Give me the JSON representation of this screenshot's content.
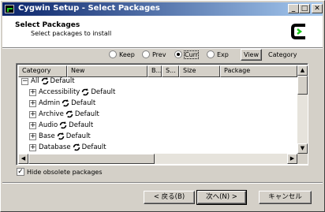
{
  "window": {
    "title": "Cygwin Setup - Select Packages",
    "controls": {
      "minimize": "_",
      "maximize": "□",
      "close": "✕"
    }
  },
  "header": {
    "title": "Select Packages",
    "subtitle": "Select packages to install",
    "logo": "cygwin-logo-icon"
  },
  "view_options": {
    "radios": [
      {
        "label": "Keep",
        "selected": false
      },
      {
        "label": "Prev",
        "selected": false
      },
      {
        "label": "Curr",
        "selected": true
      },
      {
        "label": "Exp",
        "selected": false
      }
    ],
    "view_button": "View",
    "view_mode": "Category"
  },
  "list": {
    "columns": [
      "Category",
      "New",
      "B...",
      "S...",
      "Size",
      "Package"
    ],
    "rows": [
      {
        "expander": "−",
        "name": "All",
        "status": "Default",
        "level": 0
      },
      {
        "expander": "+",
        "name": "Accessibility",
        "status": "Default",
        "level": 1
      },
      {
        "expander": "+",
        "name": "Admin",
        "status": "Default",
        "level": 1
      },
      {
        "expander": "+",
        "name": "Archive",
        "status": "Default",
        "level": 1
      },
      {
        "expander": "+",
        "name": "Audio",
        "status": "Default",
        "level": 1
      },
      {
        "expander": "+",
        "name": "Base",
        "status": "Default",
        "level": 1
      },
      {
        "expander": "+",
        "name": "Database",
        "status": "Default",
        "level": 1
      }
    ]
  },
  "options": {
    "hide_obsolete_label": "Hide obsolete packages",
    "hide_obsolete_checked": true,
    "check_mark": "✓"
  },
  "buttons": {
    "back": "< 戻る(B)",
    "next": "次へ(N) >",
    "cancel": "キャンセル"
  },
  "scroll": {
    "up": "▲",
    "down": "▼",
    "left": "◀",
    "right": "▶"
  }
}
